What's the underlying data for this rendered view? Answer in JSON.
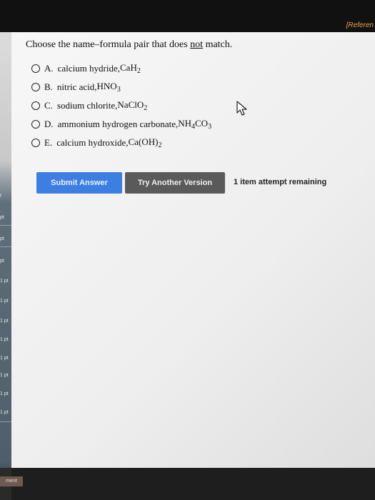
{
  "header": {
    "reference_link": "[Referen"
  },
  "question": {
    "prefix": "Choose the name–formula pair that does ",
    "emphasis": "not",
    "suffix": " match."
  },
  "options": [
    {
      "letter": "A.",
      "name": "calcium hydride, ",
      "formula_parts": [
        "CaH",
        "2",
        ""
      ]
    },
    {
      "letter": "B.",
      "name": "nitric acid, ",
      "formula_parts": [
        "HNO",
        "3",
        ""
      ]
    },
    {
      "letter": "C.",
      "name": "sodium chlorite, ",
      "formula_parts": [
        "NaClO",
        "2",
        ""
      ]
    },
    {
      "letter": "D.",
      "name": "ammonium hydrogen carbonate, ",
      "formula_parts": [
        "NH",
        "4",
        "CO",
        "3"
      ]
    },
    {
      "letter": "E.",
      "name": "calcium hydroxide, ",
      "formula_parts": [
        "Ca(OH)",
        "2",
        ""
      ]
    }
  ],
  "actions": {
    "submit_label": "Submit Answer",
    "try_label": "Try Another Version",
    "attempts_text": "1 item attempt remaining"
  },
  "left_strip": {
    "labels": [
      "t",
      "pt",
      "pt",
      "pt",
      "1 pt",
      "1 pt",
      "1 pt",
      "1 pt",
      "1 pt",
      "1 pt",
      "1 pt",
      "1 pt"
    ],
    "bottom_button": "ment"
  },
  "icons": {
    "cursor": "mouse-pointer-icon"
  }
}
